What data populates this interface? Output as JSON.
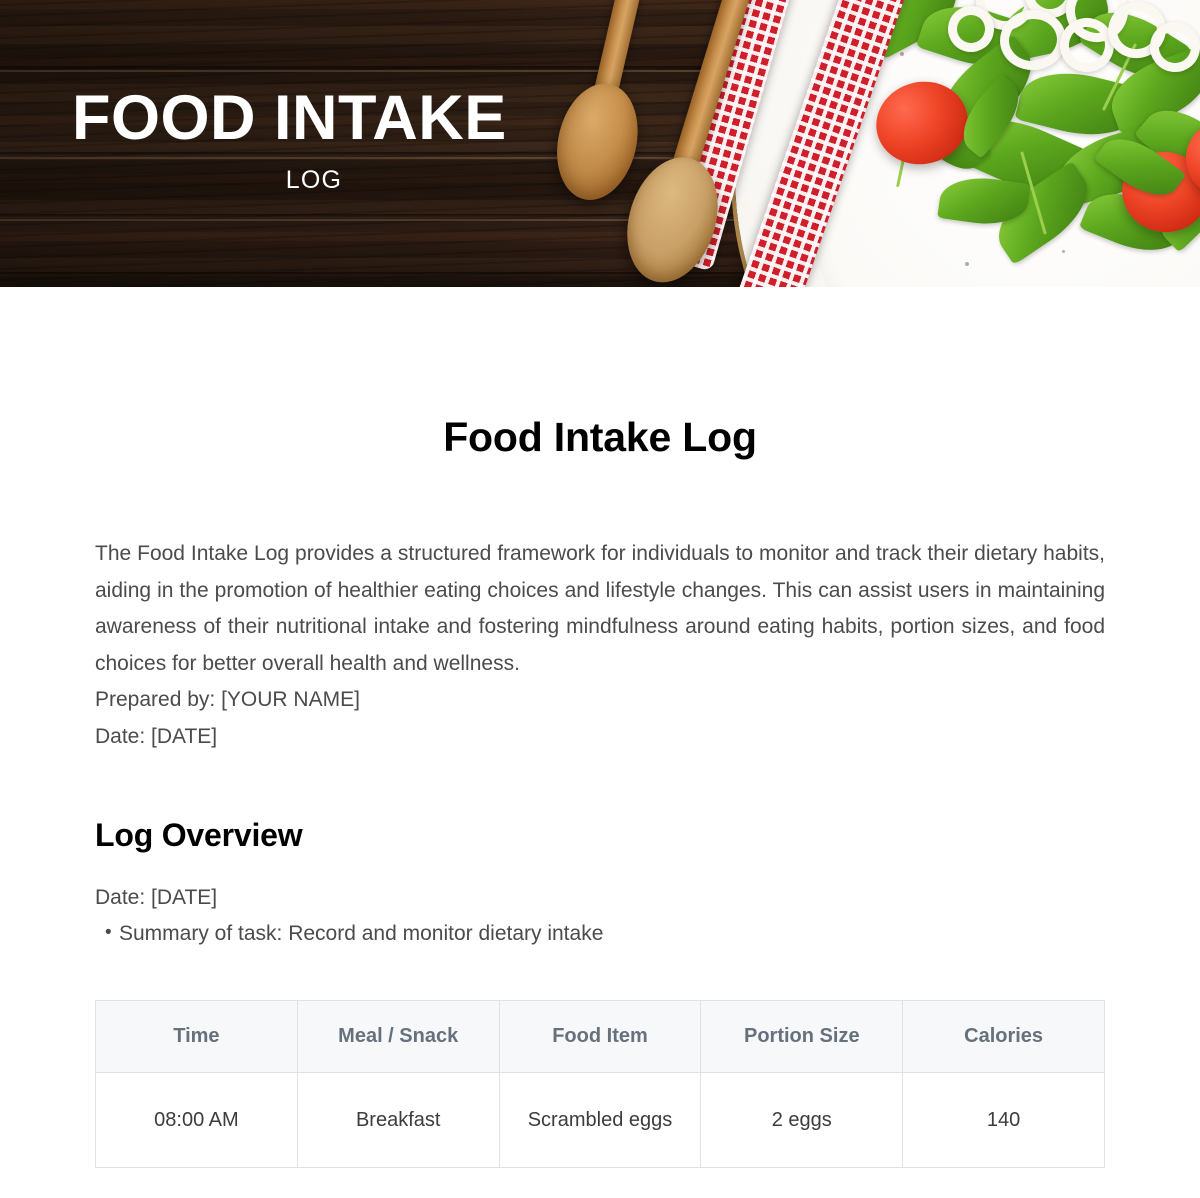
{
  "banner": {
    "title": "FOOD INTAKE",
    "subtitle": "LOG",
    "image_alt": "wooden-table-with-salad-plate-and-wooden-spoons",
    "colors": {
      "wood": "#4b3526",
      "title_color": "#ffffff",
      "gingham_red": "#cf1f2b",
      "spoon_wood": "#c8904c",
      "arugula_green": "#5da81e",
      "tomato_red": "#ef4426",
      "plate_white": "#ffffff"
    }
  },
  "document": {
    "title": "Food Intake Log",
    "intro": "The Food Intake Log provides a structured framework for individuals to monitor and track their dietary habits, aiding in the promotion of healthier eating choices and lifestyle changes. This can assist users in maintaining awareness of their nutritional intake and fostering mindfulness around eating habits, portion sizes, and food choices for better overall health and wellness.",
    "prepared_by": "Prepared by: [YOUR NAME]",
    "date": "Date: [DATE]"
  },
  "overview": {
    "heading": "Log Overview",
    "date": "Date: [DATE]",
    "bullets": [
      "Summary of task: Record and monitor dietary intake"
    ]
  },
  "table": {
    "columns": [
      "Time",
      "Meal / Snack",
      "Food Item",
      "Portion Size",
      "Calories"
    ],
    "rows": [
      {
        "time": "08:00 AM",
        "meal": "Breakfast",
        "food_item": "Scrambled eggs",
        "portion": "2 eggs",
        "calories": "140"
      }
    ]
  },
  "theme": {
    "text_color": "#4b4b4b",
    "heading_color": "#000000",
    "table_header_bg": "#f7f8f9",
    "table_header_text": "#66717d",
    "table_border": "#dfe1e4"
  }
}
